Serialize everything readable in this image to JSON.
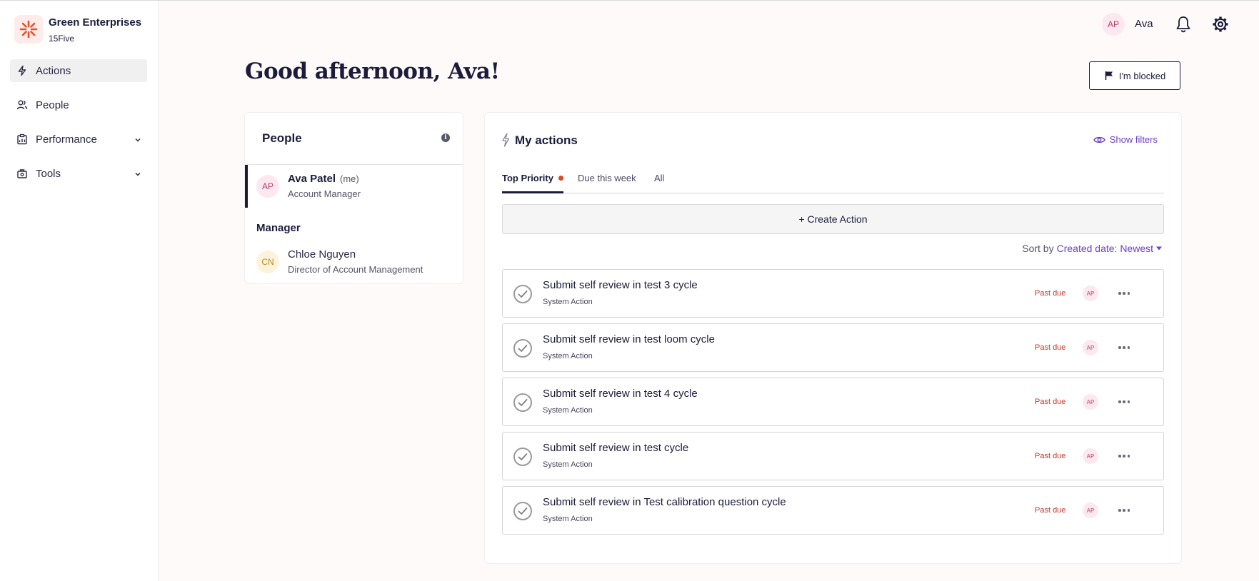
{
  "org": {
    "name": "Green Enterprises",
    "sub": "15Five"
  },
  "sidebar": {
    "items": [
      {
        "label": "Actions",
        "icon": "bolt-icon",
        "active": true
      },
      {
        "label": "People",
        "icon": "people-icon"
      },
      {
        "label": "Performance",
        "icon": "clipboard-icon",
        "expandable": true
      },
      {
        "label": "Tools",
        "icon": "toolbox-icon",
        "expandable": true
      }
    ]
  },
  "header": {
    "avatar_initials": "AP",
    "user_name": "Ava"
  },
  "greeting": "Good afternoon, Ava!",
  "blocked_button": "I'm blocked",
  "people_card": {
    "title": "People",
    "me": {
      "initials": "AP",
      "name": "Ava Patel",
      "tag": "(me)",
      "role": "Account Manager"
    },
    "manager_label": "Manager",
    "manager": {
      "initials": "CN",
      "name": "Chloe Nguyen",
      "role": "Director of Account Management"
    }
  },
  "actions_card": {
    "title": "My actions",
    "show_filters": "Show filters",
    "tabs": [
      "Top Priority",
      "Due this week",
      "All"
    ],
    "create_label": "+ Create Action",
    "sort_label": "Sort by",
    "sort_value": "Created date: Newest",
    "items": [
      {
        "title": "Submit self review in test 3 cycle",
        "sub": "System Action",
        "status": "Past due",
        "avatar": "AP"
      },
      {
        "title": "Submit self review in test loom cycle",
        "sub": "System Action",
        "status": "Past due",
        "avatar": "AP"
      },
      {
        "title": "Submit self review in test 4 cycle",
        "sub": "System Action",
        "status": "Past due",
        "avatar": "AP"
      },
      {
        "title": "Submit self review in test cycle",
        "sub": "System Action",
        "status": "Past due",
        "avatar": "AP"
      },
      {
        "title": "Submit self review in Test calibration question cycle",
        "sub": "System Action",
        "status": "Past due",
        "avatar": "AP"
      }
    ]
  },
  "colors": {
    "accent": "#6b3fc6",
    "past_due": "#c0392b",
    "tab_dot": "#d94a1f",
    "brand": "#e8502b"
  }
}
